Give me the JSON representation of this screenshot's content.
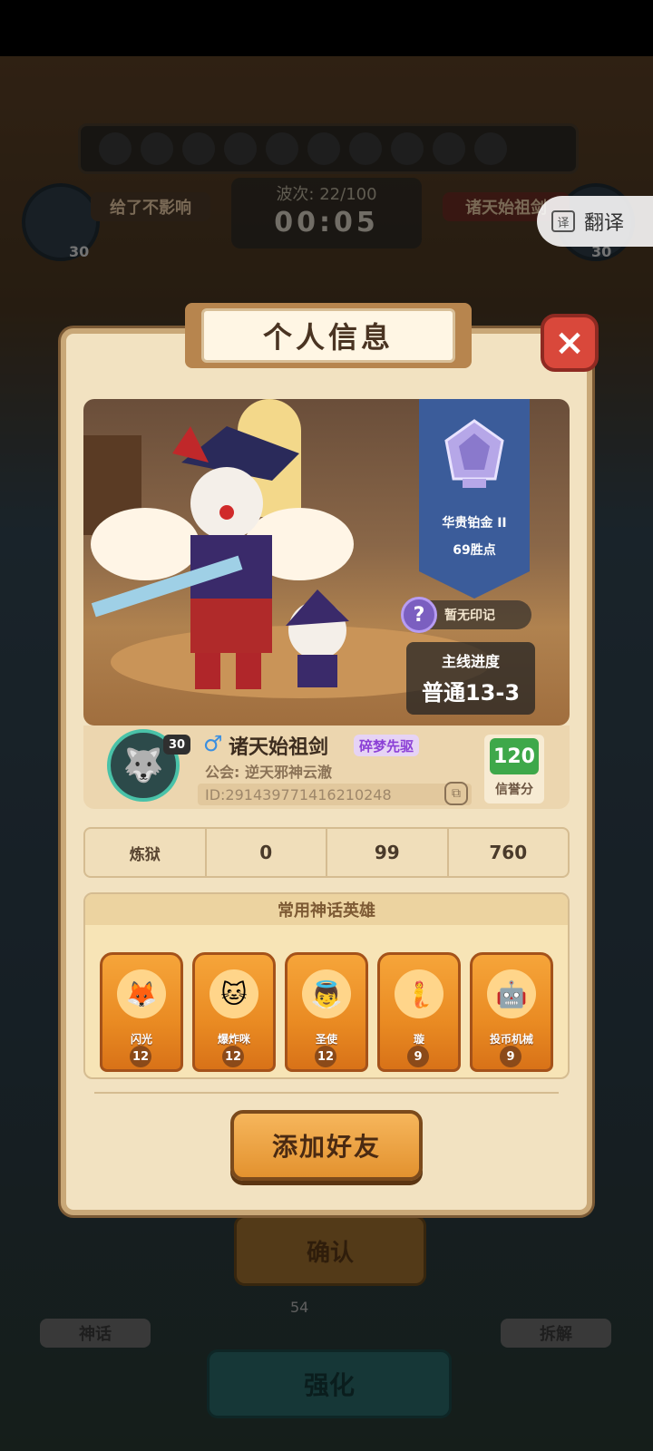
{
  "background": {
    "left_player": "给了不影响",
    "right_player": "诸天始祖剑",
    "wave_label": "波次: 22/100",
    "timer": "00:05",
    "left_level": "30",
    "right_level": "30",
    "confirm_label": "确认",
    "coin_count": "54",
    "enhance_label": "强化",
    "myth_label": "神话",
    "decompose_label": "拆解"
  },
  "translate": {
    "label": "翻译",
    "icon": "translate-icon"
  },
  "modal": {
    "title": "个人信息",
    "close_icon": "×"
  },
  "rank": {
    "name": "华贵铂金 II",
    "points": "69胜点"
  },
  "mark": {
    "icon": "?",
    "text": "暂无印记"
  },
  "progress": {
    "title": "主线进度",
    "value": "普通13-3"
  },
  "player": {
    "level": "30",
    "gender_icon": "♂",
    "name": "诸天始祖剑",
    "title_badge": "碎梦先驱",
    "guild": "公会: 逆天邪神云澈",
    "id": "ID:2914397714162102​48",
    "credit_value": "120",
    "credit_label": "信誉分"
  },
  "stats": [
    "炼狱",
    "0",
    "99",
    "760"
  ],
  "heroes_section": {
    "title": "常用神话英雄",
    "heroes": [
      {
        "name": "闪光",
        "level": "12",
        "icon": "🦊"
      },
      {
        "name": "爆炸咪",
        "level": "12",
        "icon": "🐱"
      },
      {
        "name": "圣使",
        "level": "12",
        "icon": "👼"
      },
      {
        "name": "璇",
        "level": "9",
        "icon": "🧜"
      },
      {
        "name": "投币机械",
        "level": "9",
        "icon": "🤖"
      }
    ]
  },
  "add_friend_label": "添加好友",
  "colors": {
    "modal_bg": "#f2e2c1",
    "close_red": "#d9483b",
    "rank_banner": "#3b5c9a",
    "credit_green": "#3ea84a",
    "hero_card_orange": "#e98a22",
    "button_orange": "#e3922f"
  }
}
